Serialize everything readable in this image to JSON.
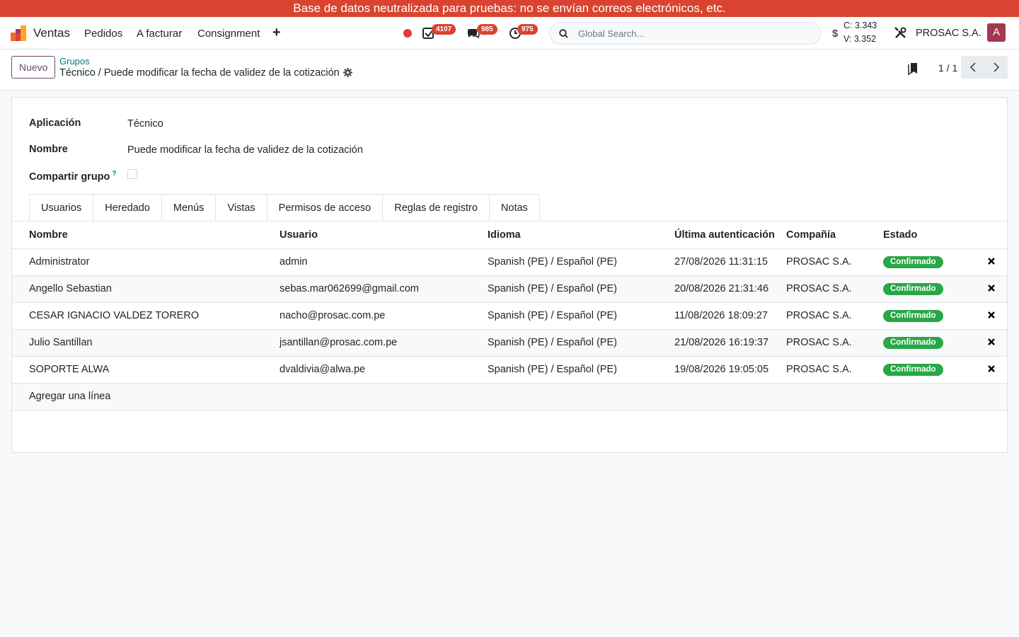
{
  "banner": {
    "text": "Base de datos neutralizada para pruebas: no se envían correos electrónicos, etc."
  },
  "navbar": {
    "app_name": "Ventas",
    "menu": [
      "Pedidos",
      "A facturar",
      "Consignment"
    ],
    "activity_count": "4107",
    "messages_count": "985",
    "timesheet_count": "975",
    "search_placeholder": "Global Search...",
    "currency_symbol": "$",
    "rate_buy": "C: 3.343",
    "rate_sell": "V: 3.352",
    "company": "PROSAC S.A.",
    "avatar_letter": "A"
  },
  "control_panel": {
    "new_label": "Nuevo",
    "breadcrumb_parent": "Grupos",
    "breadcrumb_current": "Técnico / Puede modificar la fecha de validez de la cotización",
    "pager_value": "1 / 1"
  },
  "form": {
    "application_label": "Aplicación",
    "application_value": "Técnico",
    "name_label": "Nombre",
    "name_value": "Puede modificar la fecha de validez de la cotización",
    "share_label": "Compartir grupo",
    "share_help": "?"
  },
  "tabs": [
    "Usuarios",
    "Heredado",
    "Menús",
    "Vistas",
    "Permisos de acceso",
    "Reglas de registro",
    "Notas"
  ],
  "users_table": {
    "headers": [
      "Nombre",
      "Usuario",
      "Idioma",
      "Última autenticación",
      "Compañía",
      "Estado"
    ],
    "rows": [
      {
        "name": "Administrator",
        "login": "admin",
        "lang": "Spanish (PE) / Español (PE)",
        "last_login": "27/08/2026 11:31:15",
        "company": "PROSAC S.A.",
        "state": "Confirmado"
      },
      {
        "name": "Angello Sebastian",
        "login": "sebas.mar062699@gmail.com",
        "lang": "Spanish (PE) / Español (PE)",
        "last_login": "20/08/2026 21:31:46",
        "company": "PROSAC S.A.",
        "state": "Confirmado"
      },
      {
        "name": "CESAR IGNACIO VALDEZ TORERO",
        "login": "nacho@prosac.com.pe",
        "lang": "Spanish (PE) / Español (PE)",
        "last_login": "11/08/2026 18:09:27",
        "company": "PROSAC S.A.",
        "state": "Confirmado"
      },
      {
        "name": "Julio Santillan",
        "login": "jsantillan@prosac.com.pe",
        "lang": "Spanish (PE) / Español (PE)",
        "last_login": "21/08/2026 16:19:37",
        "company": "PROSAC S.A.",
        "state": "Confirmado"
      },
      {
        "name": "SOPORTE ALWA",
        "login": "dvaldivia@alwa.pe",
        "lang": "Spanish (PE) / Español (PE)",
        "last_login": "19/08/2026 19:05:05",
        "company": "PROSAC S.A.",
        "state": "Confirmado"
      }
    ],
    "add_line": "Agregar una línea"
  },
  "colors": {
    "accent": "#714b67",
    "link": "#017e84",
    "banner": "#d9432f",
    "badge_green": "#28a745"
  }
}
